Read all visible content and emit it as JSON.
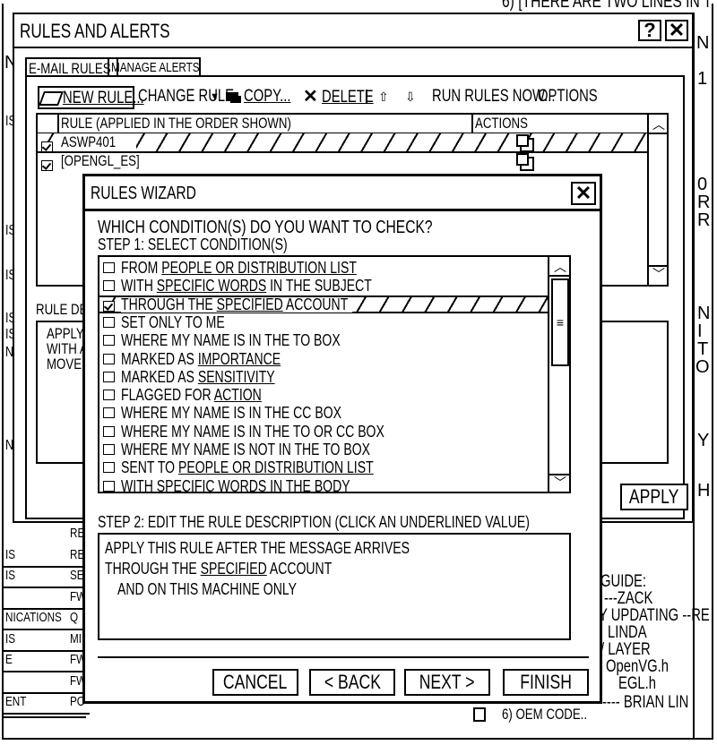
{
  "background": {
    "top_fragment": "6) [THERE ARE TWO LINES IN T",
    "right_letters": [
      "N",
      "1",
      "0",
      "R",
      "R",
      "N",
      "I",
      "T",
      "O",
      "Y",
      "H"
    ],
    "left_letters": [
      "N",
      "IS",
      "IS",
      "IS",
      "IS",
      "IS",
      "N",
      "N"
    ],
    "left_table": [
      {
        "col1": "",
        "col2": "RE"
      },
      {
        "col1": "IS",
        "col2": "RE"
      },
      {
        "col1": "IS",
        "col2": "SE"
      },
      {
        "col1": "",
        "col2": "FW"
      },
      {
        "col1": "NICATIONS",
        "col2": "Q"
      },
      {
        "col1": "IS",
        "col2": "MI"
      },
      {
        "col1": "E",
        "col2": "FW"
      },
      {
        "col1": "",
        "col2": "FW"
      },
      {
        "col1": "ENT",
        "col2": "PO"
      }
    ],
    "right_notes": [
      "GUIDE:",
      "---ZACK",
      "Y UPDATING --RE",
      "LINDA",
      "/ LAYER",
      "OpenVG.h",
      "EGL.h",
      "---- BRIAN LIN"
    ],
    "bottom_fragment": "6) OEM CODE.."
  },
  "rules_alerts": {
    "title": "RULES AND ALERTS",
    "help_label": "?",
    "close_label": "✕",
    "tabs": [
      {
        "label": "E-MAIL RULES",
        "active": true
      },
      {
        "label": "MANAGE ALERTS",
        "active": false
      }
    ],
    "toolbar": {
      "new_rule": "NEW RULE...",
      "change_rule": "CHANGE RULE",
      "copy": "COPY...",
      "delete": "DELETE",
      "run_rules_now": "RUN RULES NOW...",
      "options": "OPTIONS"
    },
    "table": {
      "col_rule": "RULE (APPLIED IN THE ORDER SHOWN)",
      "col_actions": "ACTIONS",
      "rows": [
        {
          "name": "ASWP401",
          "checked": true,
          "selected": true
        },
        {
          "name": "[OPENGL_ES]",
          "checked": true,
          "selected": false
        }
      ]
    },
    "rule_description_label": "RULE DES",
    "rule_description_lines": [
      "APPLY",
      "WITH A",
      "MOVE I"
    ],
    "apply_button": "APPLY"
  },
  "wizard": {
    "title": "RULES WIZARD",
    "close_label": "✕",
    "question": "WHICH CONDITION(S) DO YOU WANT TO CHECK?",
    "step1": "STEP 1: SELECT CONDITION(S)",
    "conditions": [
      {
        "pre": "FROM ",
        "link": "PEOPLE OR DISTRIBUTION LIST",
        "checked": false
      },
      {
        "pre": "WITH ",
        "link": "SPECIFIC WORDS",
        "post": " IN THE SUBJECT",
        "checked": false
      },
      {
        "pre": "THROUGH THE ",
        "link": "SPECIFIED",
        "post": " ACCOUNT",
        "checked": true,
        "selected": true
      },
      {
        "pre": "SET ONLY TO ME",
        "checked": false
      },
      {
        "pre": "WHERE MY NAME IS IN THE TO BOX",
        "checked": false
      },
      {
        "pre": "MARKED AS ",
        "link": "IMPORTANCE",
        "checked": false
      },
      {
        "pre": "MARKED AS ",
        "link": "SENSITIVITY",
        "checked": false
      },
      {
        "pre": "FLAGGED FOR ",
        "link": "ACTION",
        "checked": false
      },
      {
        "pre": "WHERE MY NAME IS IN THE CC BOX",
        "checked": false
      },
      {
        "pre": "WHERE MY NAME IS IN THE TO OR CC BOX",
        "checked": false
      },
      {
        "pre": "WHERE MY NAME IS NOT IN THE TO BOX",
        "checked": false
      },
      {
        "pre": "SENT TO ",
        "link": "PEOPLE OR DISTRIBUTION LIST",
        "checked": false
      },
      {
        "pre": "WITH ",
        "link": "SPECIFIC WORDS",
        "post": " IN THE BODY",
        "checked": false
      }
    ],
    "step2": "STEP 2: EDIT THE RULE DESCRIPTION (CLICK AN UNDERLINED VALUE)",
    "description": {
      "line1": "APPLY THIS RULE AFTER THE MESSAGE ARRIVES",
      "line2_pre": "THROUGH THE ",
      "line2_link": "SPECIFIED",
      "line2_post": " ACCOUNT",
      "line3": "AND ON THIS MACHINE ONLY"
    },
    "buttons": {
      "cancel": "CANCEL",
      "back": "< BACK",
      "next": "NEXT >",
      "finish": "FINISH"
    }
  }
}
